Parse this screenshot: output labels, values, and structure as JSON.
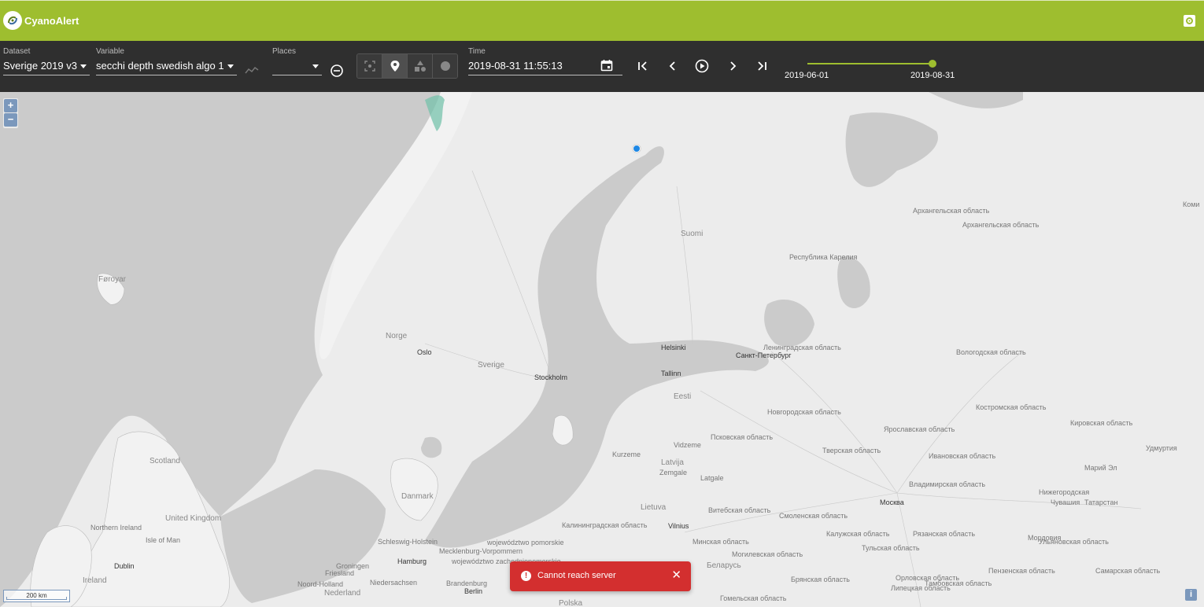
{
  "app": {
    "title": "CyanoAlert"
  },
  "toolbar": {
    "dataset": {
      "label": "Dataset",
      "value": "Sverige 2019 v3"
    },
    "variable": {
      "label": "Variable",
      "value": "secchi depth swedish algo 1"
    },
    "places": {
      "label": "Places",
      "value": ""
    },
    "time": {
      "label": "Time",
      "value": "2019-08-31 11:55:13"
    },
    "slider": {
      "start": "2019-06-01",
      "end": "2019-08-31",
      "position": 1.0
    },
    "accent_color": "#9ebe2f"
  },
  "map": {
    "zoom_in": "+",
    "zoom_out": "−",
    "scale": "200 km",
    "info": "i",
    "labels": [
      {
        "text": "Føroyar",
        "kind": "country"
      },
      {
        "text": "Norge",
        "kind": "country"
      },
      {
        "text": "Oslo",
        "kind": "city"
      },
      {
        "text": "Sverige",
        "kind": "country"
      },
      {
        "text": "Stockholm",
        "kind": "city"
      },
      {
        "text": "Suomi",
        "kind": "country"
      },
      {
        "text": "Helsinki",
        "kind": "city"
      },
      {
        "text": "Tallinn",
        "kind": "city"
      },
      {
        "text": "Eesti",
        "kind": "country"
      },
      {
        "text": "Санкт-Петербург",
        "kind": "city"
      },
      {
        "text": "Республика Карелия",
        "kind": "region"
      },
      {
        "text": "Архангельская область",
        "kind": "region"
      },
      {
        "text": "Архангельская область",
        "kind": "region"
      },
      {
        "text": "Коми",
        "kind": "region"
      },
      {
        "text": "Ленинградская область",
        "kind": "region"
      },
      {
        "text": "Вологодская область",
        "kind": "region"
      },
      {
        "text": "Новгородская область",
        "kind": "region"
      },
      {
        "text": "Костромская область",
        "kind": "region"
      },
      {
        "text": "Кировская область",
        "kind": "region"
      },
      {
        "text": "Ярославская область",
        "kind": "region"
      },
      {
        "text": "Псковская область",
        "kind": "region"
      },
      {
        "text": "Тверская область",
        "kind": "region"
      },
      {
        "text": "Ивановская область",
        "kind": "region"
      },
      {
        "text": "Удмуртия",
        "kind": "region"
      },
      {
        "text": "Марий Эл",
        "kind": "region"
      },
      {
        "text": "Vidzeme",
        "kind": "region"
      },
      {
        "text": "Kurzeme",
        "kind": "region"
      },
      {
        "text": "Latvija",
        "kind": "country"
      },
      {
        "text": "Zemgale",
        "kind": "region"
      },
      {
        "text": "Latgale",
        "kind": "region"
      },
      {
        "text": "Scotland",
        "kind": "country"
      },
      {
        "text": "Danmark",
        "kind": "country"
      },
      {
        "text": "Lietuva",
        "kind": "country"
      },
      {
        "text": "Vilnius",
        "kind": "city"
      },
      {
        "text": "Витебская область",
        "kind": "region"
      },
      {
        "text": "Смоленская область",
        "kind": "region"
      },
      {
        "text": "Москва",
        "kind": "city"
      },
      {
        "text": "Владимирская область",
        "kind": "region"
      },
      {
        "text": "Нижегородская",
        "kind": "region"
      },
      {
        "text": "Чувашия",
        "kind": "region"
      },
      {
        "text": "Татарстан",
        "kind": "region"
      },
      {
        "text": "Калининградская область",
        "kind": "region"
      },
      {
        "text": "Минская область",
        "kind": "region"
      },
      {
        "text": "Калужская область",
        "kind": "region"
      },
      {
        "text": "Рязанская область",
        "kind": "region"
      },
      {
        "text": "Мордовия",
        "kind": "region"
      },
      {
        "text": "Ульяновская область",
        "kind": "region"
      },
      {
        "text": "Northern Ireland",
        "kind": "region"
      },
      {
        "text": "United Kingdom",
        "kind": "country"
      },
      {
        "text": "Isle of Man",
        "kind": "region"
      },
      {
        "text": "Schleswig-Holstein",
        "kind": "region"
      },
      {
        "text": "województwo pomorskie",
        "kind": "region"
      },
      {
        "text": "Mecklenburg-Vorpommern",
        "kind": "region"
      },
      {
        "text": "Hamburg",
        "kind": "city"
      },
      {
        "text": "województwo zachodniopomorskie",
        "kind": "region"
      },
      {
        "text": "Могилевская область",
        "kind": "region"
      },
      {
        "text": "Беларусь",
        "kind": "country"
      },
      {
        "text": "Тульская область",
        "kind": "region"
      },
      {
        "text": "Пензенская область",
        "kind": "region"
      },
      {
        "text": "Самарская область",
        "kind": "region"
      },
      {
        "text": "Dublin",
        "kind": "city"
      },
      {
        "text": "Ireland",
        "kind": "country"
      },
      {
        "text": "Groningen",
        "kind": "region"
      },
      {
        "text": "Friesland",
        "kind": "region"
      },
      {
        "text": "Noord-Holland",
        "kind": "region"
      },
      {
        "text": "Nederland",
        "kind": "country"
      },
      {
        "text": "Niedersachsen",
        "kind": "region"
      },
      {
        "text": "Brandenburg",
        "kind": "region"
      },
      {
        "text": "Berlin",
        "kind": "city"
      },
      {
        "text": "Брянская область",
        "kind": "region"
      },
      {
        "text": "Орловская область",
        "kind": "region"
      },
      {
        "text": "Липецкая область",
        "kind": "region"
      },
      {
        "text": "Тамбовская область",
        "kind": "region"
      },
      {
        "text": "Гомельская область",
        "kind": "region"
      },
      {
        "text": "Polska",
        "kind": "country"
      }
    ]
  },
  "snackbar": {
    "message": "Cannot reach server",
    "close": "✕",
    "icon": "!"
  }
}
